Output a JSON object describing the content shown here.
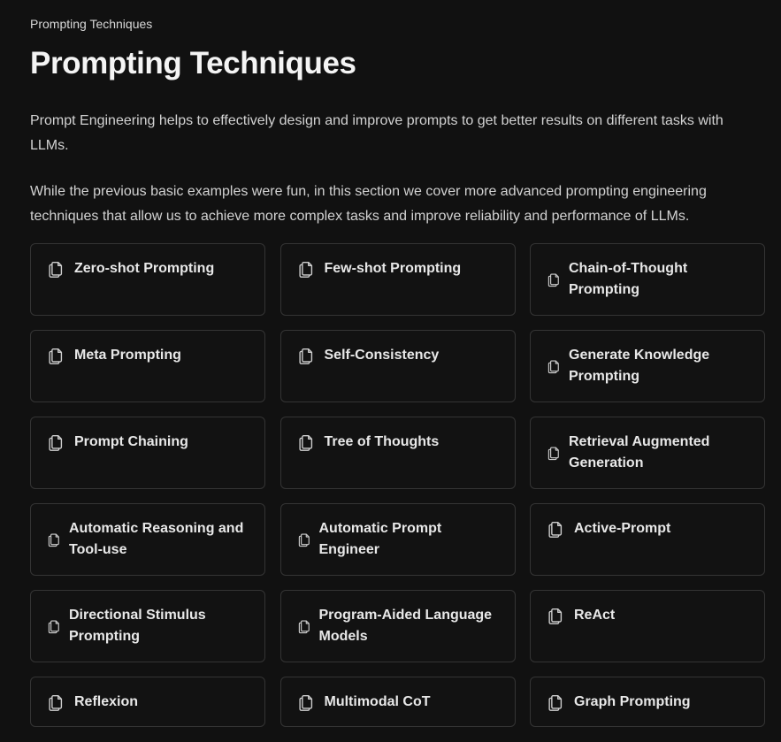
{
  "breadcrumb": "Prompting Techniques",
  "title": "Prompting Techniques",
  "paragraphs": [
    "Prompt Engineering helps to effectively design and improve prompts to get better results on different tasks with LLMs.",
    "While the previous basic examples were fun, in this section we cover more advanced prompting engineering techniques that allow us to achieve more complex tasks and improve reliability and performance of LLMs."
  ],
  "cards": [
    {
      "label": "Zero-shot Prompting",
      "icon": "document-icon"
    },
    {
      "label": "Few-shot Prompting",
      "icon": "document-icon"
    },
    {
      "label": "Chain-of-Thought Prompting",
      "icon": "document-icon"
    },
    {
      "label": "Meta Prompting",
      "icon": "document-icon"
    },
    {
      "label": "Self-Consistency",
      "icon": "document-icon"
    },
    {
      "label": "Generate Knowledge Prompting",
      "icon": "document-icon"
    },
    {
      "label": "Prompt Chaining",
      "icon": "document-icon"
    },
    {
      "label": "Tree of Thoughts",
      "icon": "document-icon"
    },
    {
      "label": "Retrieval Augmented Generation",
      "icon": "document-icon"
    },
    {
      "label": "Automatic Reasoning and Tool-use",
      "icon": "document-icon"
    },
    {
      "label": "Automatic Prompt Engineer",
      "icon": "document-icon"
    },
    {
      "label": "Active-Prompt",
      "icon": "document-icon"
    },
    {
      "label": "Directional Stimulus Prompting",
      "icon": "document-icon"
    },
    {
      "label": "Program-Aided Language Models",
      "icon": "document-icon"
    },
    {
      "label": "ReAct",
      "icon": "document-icon"
    },
    {
      "label": "Reflexion",
      "icon": "document-icon"
    },
    {
      "label": "Multimodal CoT",
      "icon": "document-icon"
    },
    {
      "label": "Graph Prompting",
      "icon": "document-icon"
    }
  ],
  "colors": {
    "background": "#111111",
    "card_border": "#343434",
    "text": "#e8e8e8"
  }
}
